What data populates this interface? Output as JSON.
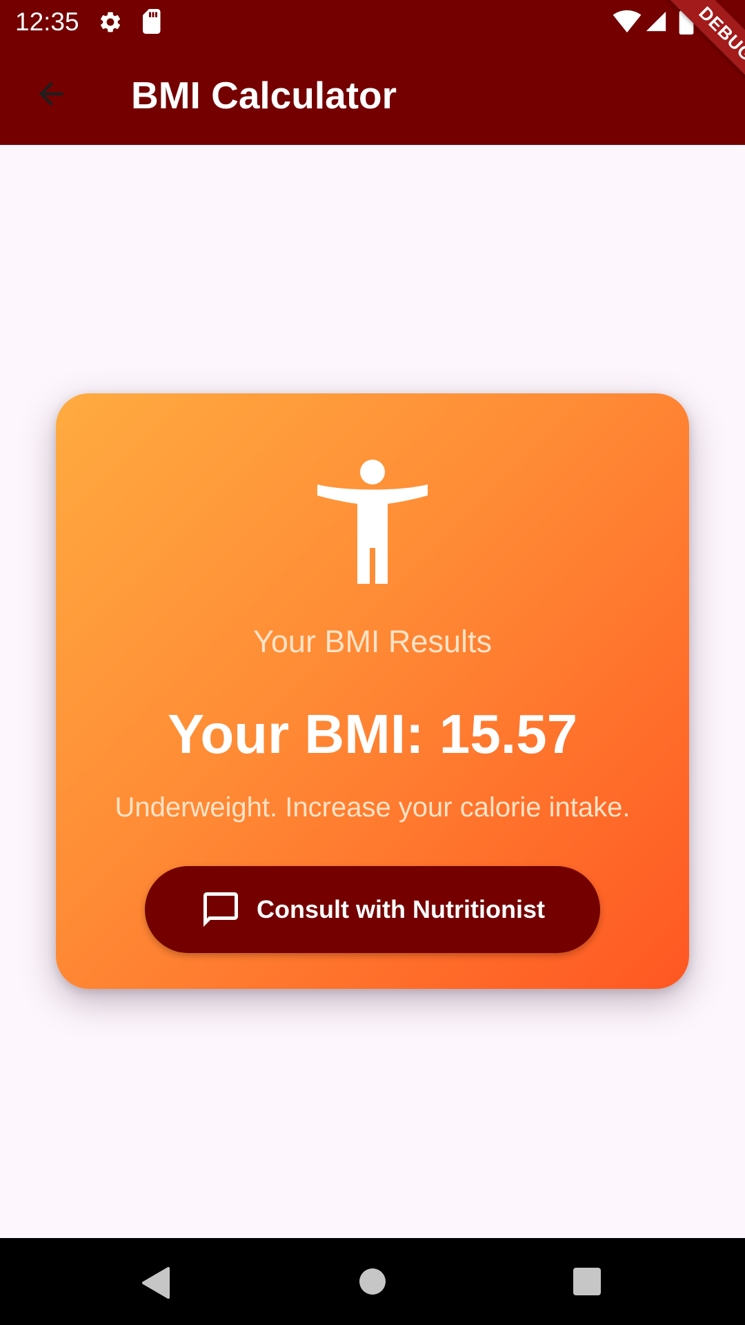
{
  "status_bar": {
    "time": "12:35",
    "icons": [
      "settings-icon",
      "sd-card-icon",
      "wifi-icon",
      "signal-icon",
      "battery-icon"
    ]
  },
  "app_bar": {
    "title": "BMI Calculator",
    "back_icon": "arrow-back-icon",
    "background_color": "#740000"
  },
  "debug_banner": {
    "label": "DEBUG"
  },
  "result_card": {
    "icon": "accessibility-person-icon",
    "subtitle": "Your BMI Results",
    "bmi_text": "Your BMI: 15.57",
    "advice": "Underweight. Increase your calorie intake.",
    "gradient_colors": [
      "#ffab40",
      "#ff5722"
    ],
    "consult_button": {
      "label": "Consult with Nutritionist",
      "icon": "chat-bubble-icon",
      "color": "#740000"
    }
  },
  "nav_bar": {
    "buttons": [
      "nav-back-icon",
      "nav-home-icon",
      "nav-recents-icon"
    ]
  }
}
